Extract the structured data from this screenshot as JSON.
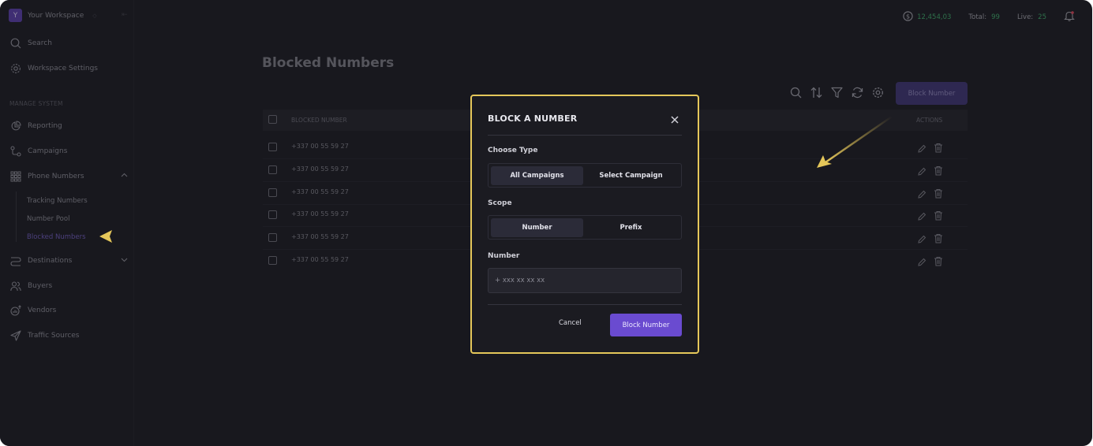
{
  "workspace": {
    "initial": "Y",
    "name": "Your Workspace"
  },
  "nav": {
    "search": "Search",
    "workspace_settings": "Workspace Settings",
    "section_label": "MANAGE SYSTEM",
    "reporting": "Reporting",
    "campaigns": "Campaigns",
    "phone_numbers": "Phone Numbers",
    "sub_items": [
      "Tracking Numbers",
      "Number Pool",
      "Blocked Numbers"
    ],
    "destinations": "Destinations",
    "buyers": "Buyers",
    "vendors": "Vendors",
    "traffic_sources": "Traffic Sources"
  },
  "topbar": {
    "balance": "12,454,03",
    "total_label": "Total:",
    "total_value": "99",
    "live_label": "Live:",
    "live_value": "25"
  },
  "page": {
    "title": "Blocked Numbers",
    "block_button": "Block Number",
    "columns": {
      "number": "BLOCKED NUMBER",
      "actions": "ACTIONS"
    },
    "rows": [
      "+337 00 55 59 27",
      "+337 00 55 59 27",
      "+337 00 55 59 27",
      "+337 00 55 59 27",
      "+337 00 55 59 27",
      "+337 00 55 59 27"
    ]
  },
  "modal": {
    "title": "BLOCK A NUMBER",
    "choose_type_label": "Choose Type",
    "type_options": [
      "All Campaigns",
      "Select Campaign"
    ],
    "scope_label": "Scope",
    "scope_options": [
      "Number",
      "Prefix"
    ],
    "number_label": "Number",
    "number_placeholder": "+ xxx xx xx xx",
    "cancel": "Cancel",
    "submit": "Block Number"
  },
  "colors": {
    "background": "#1e1e25",
    "accent": "#6a4bd0",
    "highlight": "#e5c75a",
    "positive": "#3fa56a"
  }
}
